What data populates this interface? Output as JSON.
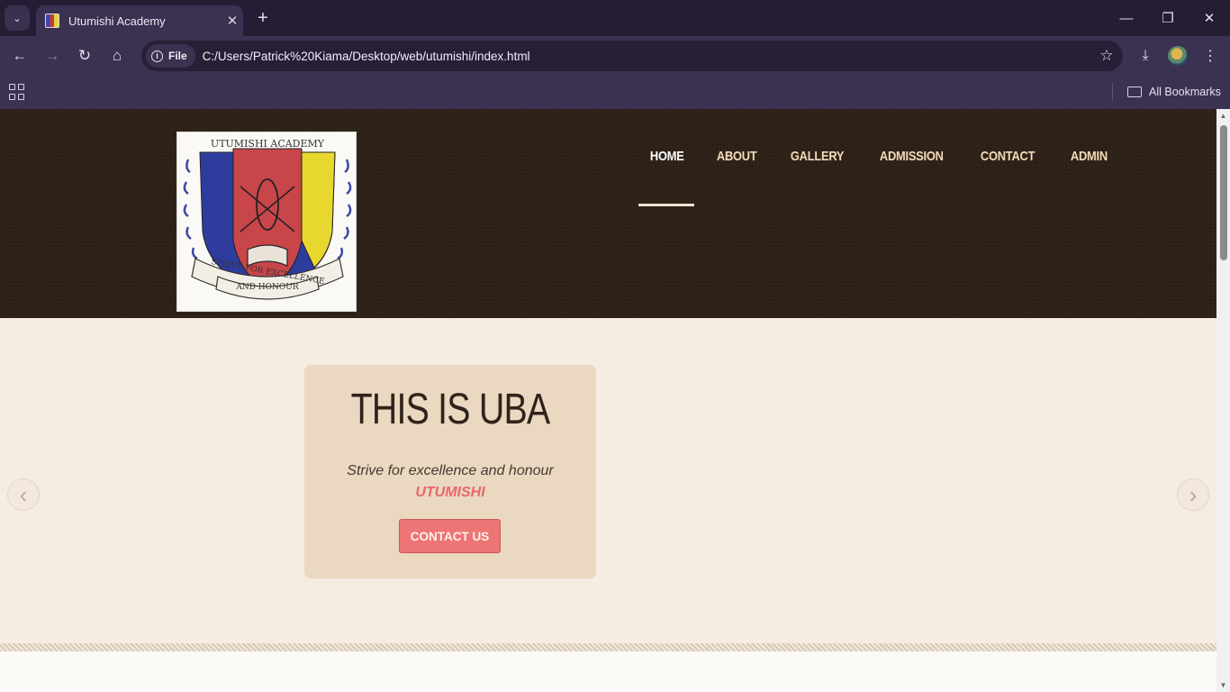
{
  "browser": {
    "tab_title": "Utumishi Academy",
    "new_tab_icon": "plus-icon",
    "address": {
      "chip_label": "File",
      "url": "C:/Users/Patrick%20Kiama/Desktop/web/utumishi/index.html"
    },
    "bookmarks_label": "All Bookmarks"
  },
  "site": {
    "logo_text_top": "UTUMISHI ACADEMY",
    "logo_text_motto": "STRIVE FOR EXCELLENCE",
    "logo_text_motto2": "AND HONOUR",
    "nav": [
      {
        "label": "HOME",
        "active": true
      },
      {
        "label": "ABOUT"
      },
      {
        "label": "GALLERY"
      },
      {
        "label": "ADMISSION"
      },
      {
        "label": "CONTACT"
      },
      {
        "label": "ADMIN"
      }
    ],
    "hero": {
      "title": "THIS IS UBA",
      "motto": "Strive for excellence and honour",
      "name": "UTUMISHI",
      "button": "CONTACT US"
    }
  },
  "colors": {
    "header_bg": "#2d2117",
    "nav_text": "#f3dcb8",
    "hero_bg": "#f5ece2",
    "hero_box": "#ead8c1",
    "accent": "#ee7575"
  }
}
